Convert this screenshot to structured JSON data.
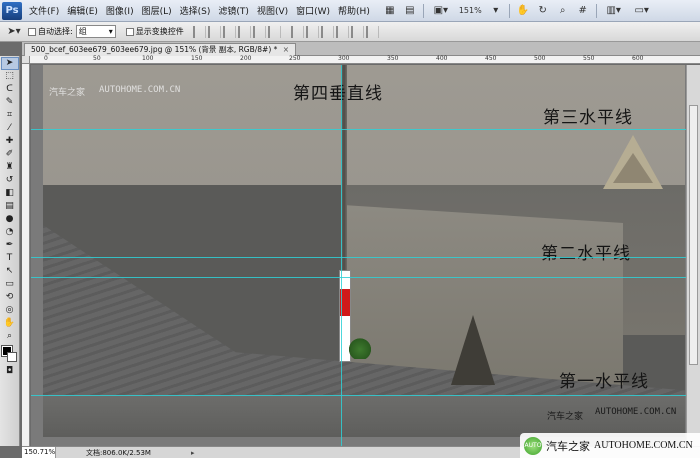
{
  "menubar": {
    "logo": "Ps",
    "items": [
      "文件(F)",
      "编辑(E)",
      "图像(I)",
      "图层(L)",
      "选择(S)",
      "滤镜(T)",
      "视图(V)",
      "窗口(W)",
      "帮助(H)"
    ],
    "zoom_level": "151%"
  },
  "optbar": {
    "auto_select_label": "自动选择:",
    "auto_select_value": "组",
    "show_transform_label": "显示变换控件"
  },
  "document": {
    "tab_title": "500_bcef_603ee679_603ee679.jpg @ 151% (背景 副本, RGB/8#) *",
    "close": "×"
  },
  "rulers": {
    "h_ticks": [
      "0",
      "50",
      "100",
      "150",
      "200",
      "250",
      "300",
      "350",
      "400",
      "450",
      "500",
      "550",
      "600"
    ]
  },
  "canvas": {
    "labels": {
      "v4": "第四垂直线",
      "h3": "第三水平线",
      "h2": "第二水平线",
      "h1": "第一水平线"
    },
    "watermark_top": "AUTOHOME.COM.CN",
    "watermark_top_cn": "汽车之家",
    "watermark_bottom": "AUTOHOME.COM.CN",
    "watermark_bottom_cn": "汽车之家"
  },
  "statusbar": {
    "zoom": "150.71%",
    "doc_info": "文档:806.0K/2.53M"
  },
  "badge": {
    "circle": "AUTO",
    "cn": "汽车之家",
    "url": "AUTOHOME.COM.CN"
  },
  "colors": {
    "guide": "#2fd0d6",
    "post_red": "#d01a1a"
  }
}
